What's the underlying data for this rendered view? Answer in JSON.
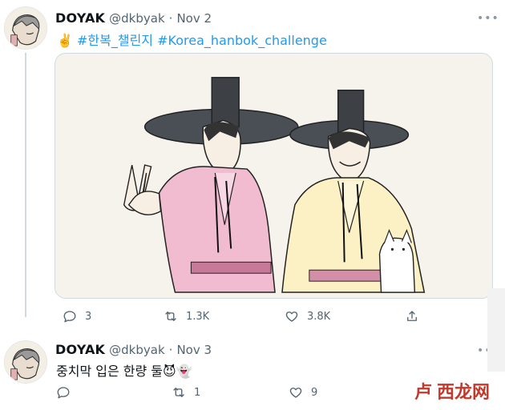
{
  "tweets": [
    {
      "display_name": "DOYAK",
      "handle": "@dkbyak",
      "separator": "·",
      "date": "Nov 2",
      "more": "•••",
      "text_prefix": "✌️",
      "hashtags": [
        "#한복_챌린지",
        "#Korea_hanbok_challenge"
      ],
      "actions": {
        "reply_count": "3",
        "retweet_count": "1.3K",
        "like_count": "3.8K"
      }
    },
    {
      "display_name": "DOYAK",
      "handle": "@dkbyak",
      "separator": "·",
      "date": "Nov 3",
      "more": "•••",
      "text": "중치막 입은 한량 둘😈👻",
      "actions": {
        "reply_count": "",
        "retweet_count": "1",
        "like_count": "9"
      }
    }
  ],
  "watermark": {
    "mark": "卢",
    "text": "西龙网"
  },
  "colors": {
    "hashtag": "#1d9bf0",
    "secondary_text": "#536471",
    "thread_line": "#cfd9de",
    "watermark": "#c0392b"
  },
  "icons": [
    "reply-icon",
    "retweet-icon",
    "like-icon",
    "share-icon",
    "more-icon"
  ]
}
